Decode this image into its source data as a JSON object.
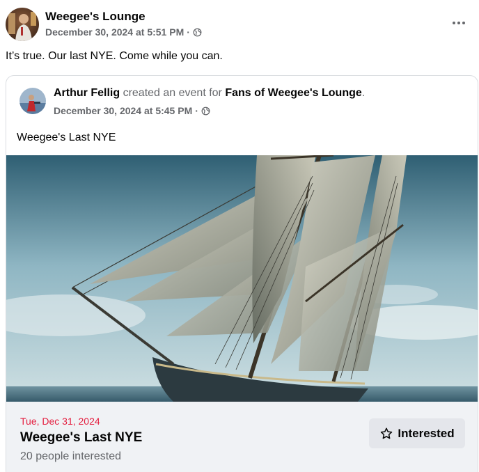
{
  "post": {
    "author": "Weegee's Lounge",
    "timestamp": "December 30, 2024 at 5:51 PM",
    "separator": "·",
    "audience_icon": "globe-icon",
    "more_icon": "more-options-icon",
    "text": "It’s true. Our last NYE. Come while you can."
  },
  "shared": {
    "creator": "Arthur Fellig",
    "action": "created an event for",
    "group": "Fans of Weegee's Lounge",
    "period": ".",
    "timestamp": "December 30, 2024 at 5:45 PM",
    "separator": "·",
    "audience_icon": "globe-icon",
    "title": "Weegee's Last NYE"
  },
  "event": {
    "date": "Tue, Dec 31, 2024",
    "name": "Weegee's Last NYE",
    "interested_count": "20 people interested",
    "button_label": "Interested",
    "button_icon": "star-outline-icon",
    "accent_color": "#e41e3f"
  }
}
